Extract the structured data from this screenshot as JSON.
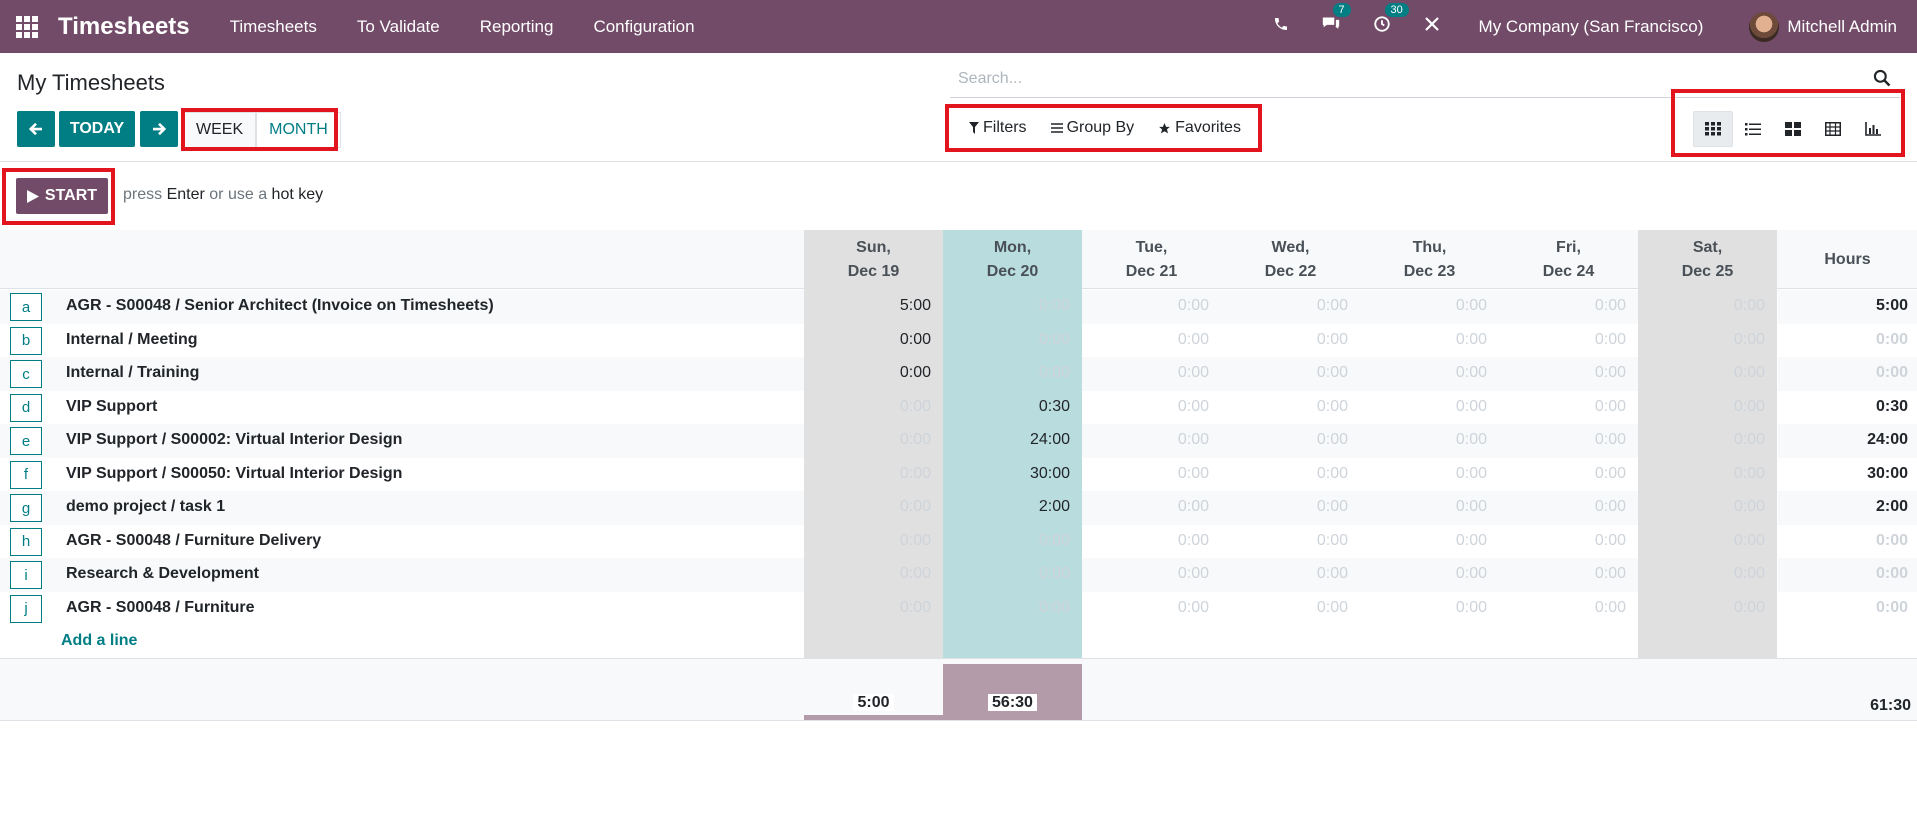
{
  "navbar": {
    "brand": "Timesheets",
    "menu": [
      "Timesheets",
      "To Validate",
      "Reporting",
      "Configuration"
    ],
    "messages_count": "7",
    "activities_count": "30",
    "company": "My Company (San Francisco)",
    "user": "Mitchell Admin",
    "brand_color": "#714b67"
  },
  "control": {
    "title": "My Timesheets",
    "search_placeholder": "Search...",
    "today_label": "TODAY",
    "week_label": "WEEK",
    "month_label": "MONTH",
    "filters_label": "Filters",
    "groupby_label": "Group By",
    "favorites_label": "Favorites",
    "views": [
      "grid-view",
      "list-view",
      "kanban-view",
      "pivot-view",
      "graph-view"
    ]
  },
  "timer": {
    "start_label": "START",
    "hint_press": "press",
    "hint_enter": "Enter",
    "hint_or": "or use a",
    "hint_hotkey": "hot key"
  },
  "grid": {
    "days": [
      {
        "weekday": "Sun,",
        "date": "Dec 19"
      },
      {
        "weekday": "Mon,",
        "date": "Dec 20"
      },
      {
        "weekday": "Tue,",
        "date": "Dec 21"
      },
      {
        "weekday": "Wed,",
        "date": "Dec 22"
      },
      {
        "weekday": "Thu,",
        "date": "Dec 23"
      },
      {
        "weekday": "Fri,",
        "date": "Dec 24"
      },
      {
        "weekday": "Sat,",
        "date": "Dec 25"
      }
    ],
    "hours_header": "Hours",
    "rows": [
      {
        "key": "a",
        "label": "AGR - S00048  /  Senior Architect (Invoice on Timesheets)",
        "values": [
          "5:00",
          "0:00",
          "0:00",
          "0:00",
          "0:00",
          "0:00",
          "0:00"
        ],
        "total": "5:00"
      },
      {
        "key": "b",
        "label": "Internal  /  Meeting",
        "values": [
          "0:00",
          "0:00",
          "0:00",
          "0:00",
          "0:00",
          "0:00",
          "0:00"
        ],
        "total": "0:00"
      },
      {
        "key": "c",
        "label": "Internal  /  Training",
        "values": [
          "0:00",
          "0:00",
          "0:00",
          "0:00",
          "0:00",
          "0:00",
          "0:00"
        ],
        "total": "0:00"
      },
      {
        "key": "d",
        "label": "VIP Support",
        "values": [
          "0:00",
          "0:30",
          "0:00",
          "0:00",
          "0:00",
          "0:00",
          "0:00"
        ],
        "total": "0:30"
      },
      {
        "key": "e",
        "label": "VIP Support  /  S00002: Virtual Interior Design",
        "values": [
          "0:00",
          "24:00",
          "0:00",
          "0:00",
          "0:00",
          "0:00",
          "0:00"
        ],
        "total": "24:00"
      },
      {
        "key": "f",
        "label": "VIP Support  /  S00050: Virtual Interior Design",
        "values": [
          "0:00",
          "30:00",
          "0:00",
          "0:00",
          "0:00",
          "0:00",
          "0:00"
        ],
        "total": "30:00"
      },
      {
        "key": "g",
        "label": "demo project  /  task 1",
        "values": [
          "0:00",
          "2:00",
          "0:00",
          "0:00",
          "0:00",
          "0:00",
          "0:00"
        ],
        "total": "2:00"
      },
      {
        "key": "h",
        "label": "AGR - S00048  /  Furniture Delivery",
        "values": [
          "0:00",
          "0:00",
          "0:00",
          "0:00",
          "0:00",
          "0:00",
          "0:00"
        ],
        "total": "0:00"
      },
      {
        "key": "i",
        "label": "Research & Development",
        "values": [
          "0:00",
          "0:00",
          "0:00",
          "0:00",
          "0:00",
          "0:00",
          "0:00"
        ],
        "total": "0:00"
      },
      {
        "key": "j",
        "label": "AGR - S00048  /  Furniture",
        "values": [
          "0:00",
          "0:00",
          "0:00",
          "0:00",
          "0:00",
          "0:00",
          "0:00"
        ],
        "total": "0:00"
      }
    ],
    "add_line_label": "Add a line",
    "day_totals": [
      "5:00",
      "56:30",
      "",
      "",
      "",
      "",
      ""
    ],
    "day_hours": [
      5,
      56.5,
      0,
      0,
      0,
      0,
      0
    ],
    "grand_total": "61:30",
    "highlight_columns": {
      "weekend": [
        0,
        6
      ],
      "today": 1
    },
    "colors": {
      "weekend": "#e0e0e0",
      "today": "#b9dcde",
      "accent": "#017e84"
    }
  }
}
